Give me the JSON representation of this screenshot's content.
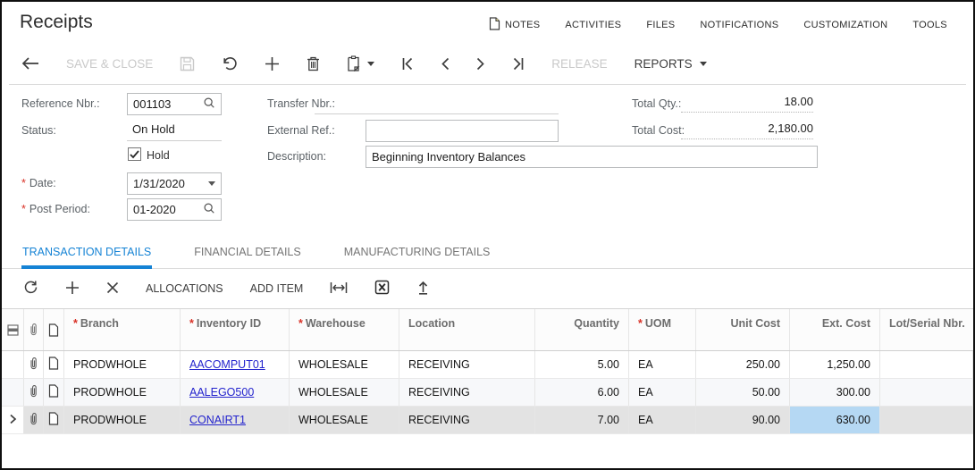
{
  "misc": {
    "required_marker": "*"
  },
  "header": {
    "title": "Receipts",
    "menu": [
      {
        "label": "NOTES"
      },
      {
        "label": "ACTIVITIES"
      },
      {
        "label": "FILES"
      },
      {
        "label": "NOTIFICATIONS"
      },
      {
        "label": "CUSTOMIZATION"
      },
      {
        "label": "TOOLS"
      }
    ]
  },
  "toolbar": {
    "save_and_close": "SAVE & CLOSE",
    "release": "RELEASE",
    "reports": "REPORTS"
  },
  "form": {
    "reference_nbr_label": "Reference Nbr.:",
    "reference_nbr": "001103",
    "status_label": "Status:",
    "status": "On Hold",
    "hold_label": "Hold",
    "hold_checked": true,
    "date_label": "Date:",
    "date": "1/31/2020",
    "post_period_label": "Post Period:",
    "post_period": "01-2020",
    "transfer_nbr_label": "Transfer Nbr.:",
    "transfer_nbr": "",
    "external_ref_label": "External Ref.:",
    "external_ref": "",
    "description_label": "Description:",
    "description": "Beginning Inventory Balances",
    "total_qty_label": "Total Qty.:",
    "total_qty": "18.00",
    "total_cost_label": "Total Cost:",
    "total_cost": "2,180.00"
  },
  "tabs": [
    {
      "label": "TRANSACTION DETAILS",
      "active": true
    },
    {
      "label": "FINANCIAL DETAILS",
      "active": false
    },
    {
      "label": "MANUFACTURING DETAILS",
      "active": false
    }
  ],
  "grid_toolbar": {
    "allocations": "ALLOCATIONS",
    "add_item": "ADD ITEM"
  },
  "grid": {
    "columns": [
      {
        "key": "branch",
        "label": "Branch",
        "required": true,
        "align": "left",
        "link": false
      },
      {
        "key": "inventory_id",
        "label": "Inventory ID",
        "required": true,
        "align": "left",
        "link": true
      },
      {
        "key": "warehouse",
        "label": "Warehouse",
        "required": true,
        "align": "left",
        "link": false
      },
      {
        "key": "location",
        "label": "Location",
        "required": false,
        "align": "left",
        "link": false
      },
      {
        "key": "quantity",
        "label": "Quantity",
        "required": false,
        "align": "right",
        "link": false
      },
      {
        "key": "uom",
        "label": "UOM",
        "required": true,
        "align": "left",
        "link": false
      },
      {
        "key": "unit_cost",
        "label": "Unit Cost",
        "required": false,
        "align": "right",
        "link": false
      },
      {
        "key": "ext_cost",
        "label": "Ext. Cost",
        "required": false,
        "align": "right",
        "link": false
      },
      {
        "key": "lot_serial",
        "label": "Lot/Serial Nbr.",
        "required": false,
        "align": "left",
        "link": false
      }
    ],
    "rows": [
      {
        "branch": "PRODWHOLE",
        "inventory_id": "AACOMPUT01",
        "warehouse": "WHOLESALE",
        "location": "RECEIVING",
        "quantity": "5.00",
        "uom": "EA",
        "unit_cost": "250.00",
        "ext_cost": "1,250.00",
        "lot_serial": ""
      },
      {
        "branch": "PRODWHOLE",
        "inventory_id": "AALEGO500",
        "warehouse": "WHOLESALE",
        "location": "RECEIVING",
        "quantity": "6.00",
        "uom": "EA",
        "unit_cost": "50.00",
        "ext_cost": "300.00",
        "lot_serial": ""
      },
      {
        "branch": "PRODWHOLE",
        "inventory_id": "CONAIRT1",
        "warehouse": "WHOLESALE",
        "location": "RECEIVING",
        "quantity": "7.00",
        "uom": "EA",
        "unit_cost": "90.00",
        "ext_cost": "630.00",
        "lot_serial": ""
      }
    ],
    "selected_row_index": 2,
    "selected_cell_key": "ext_cost"
  },
  "colors": {
    "accent_blue": "#1583d5",
    "link_blue": "#2323cd",
    "selected_cell_blue": "#b5d8f3",
    "selected_row_gray": "#e3e3e3",
    "required_red": "#d93025"
  }
}
